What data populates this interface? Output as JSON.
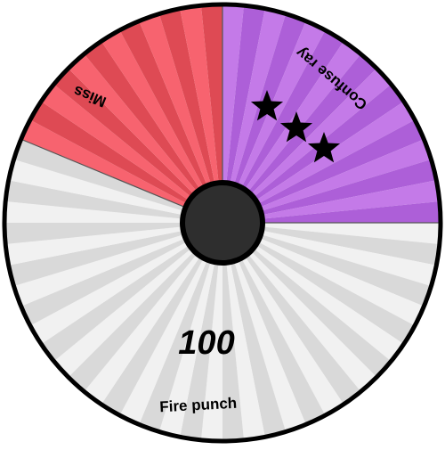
{
  "wheel": {
    "segments": [
      {
        "id": "fire-punch",
        "label": "Fire punch",
        "power": "100",
        "stars": 0,
        "share": 0.5625,
        "color_light": "#f1f1f1",
        "color_dark": "#d9d9d9"
      },
      {
        "id": "miss",
        "label": "Miss",
        "power": "",
        "stars": 0,
        "share": 0.1875,
        "color_light": "#f7636f",
        "color_dark": "#de4a54"
      },
      {
        "id": "confuse-ray",
        "label": "Confuse ray",
        "power": "",
        "stars": 3,
        "share": 0.25,
        "color_light": "#c47ae8",
        "color_dark": "#ad5fd8"
      }
    ],
    "hub_color": "#2e2e2e",
    "rim_color": "#000000",
    "star_icon": "star-icon"
  }
}
